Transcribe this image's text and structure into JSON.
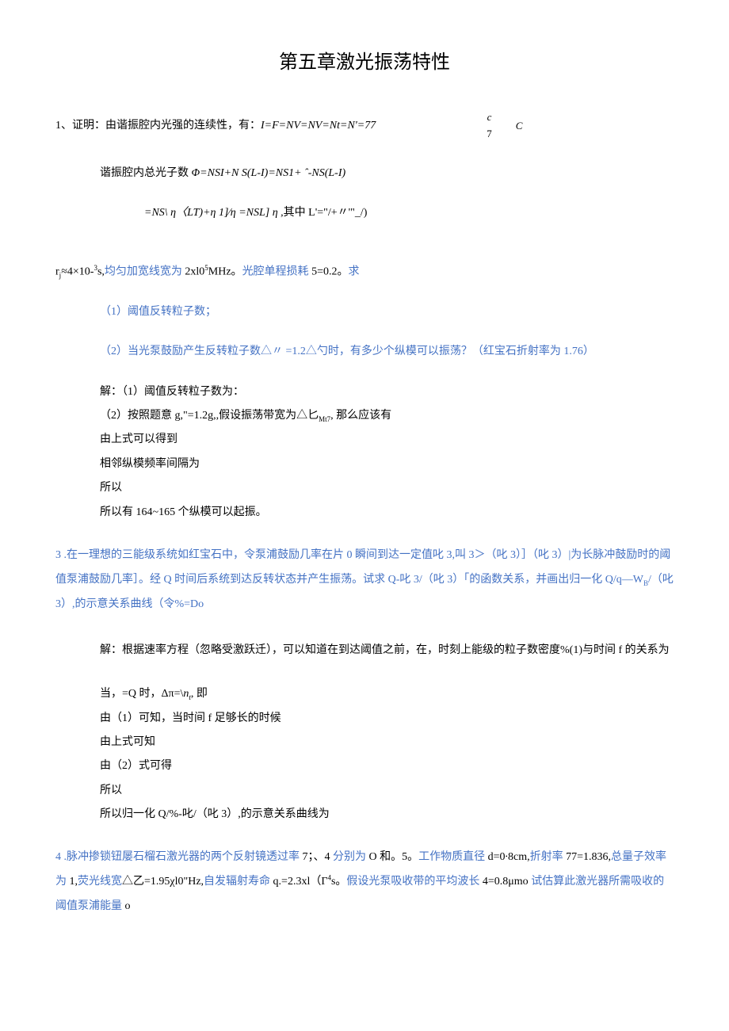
{
  "title": "第五章激光振荡特性",
  "p1": {
    "label": "1、证明：由谐振腔内光强的连续性，有：",
    "formula": "I=F=NV=NV=Nt=N'=77",
    "frac1_top": "c",
    "frac1_bot": "7",
    "frac2_top": "C"
  },
  "p2": {
    "prefix": "谐振腔内总光子数 ",
    "formula": "Φ=NSI+N S(L-I)=NS1+ ˆ-NS(L-I)"
  },
  "p3": {
    "formula": "=NS\\ η〈LT)+η 1]∕η =NSL] η ,",
    "suffix": "其中 L'=\"/+〃'\"_/)"
  },
  "p4": {
    "prefix": "r",
    "sub": "j",
    "mid1": "≈4×10-",
    "sup1": "3",
    "mid2": "s,",
    "blue1": "均匀加宽线宽为",
    "mid3": " 2xl0",
    "sup2": "5",
    "mid4": "MHz。",
    "blue2": "光腔单程损耗",
    "mid5": " 5=0.2。",
    "blue3": "求"
  },
  "p5": "（1）阈值反转粒子数；",
  "p6": "（2）当光泵鼓励产生反转粒子数△〃 =1.2△勺时，有多少个纵模可以振荡？（红宝石折射率为 1.76）",
  "p7": "解：（1）阈值反转粒子数为：",
  "p8": {
    "prefix": "（2）按照题意 g,\"=1.2g,,假设振荡带宽为△匕",
    "sub": "Mt7",
    "suffix": ", 那么应该有"
  },
  "p9": "由上式可以得到",
  "p10": "相邻纵模频率间隔为",
  "p11": "所以",
  "p12": "所以有 164~165 个纵模可以起振。",
  "p13": "3 .在一理想的三能级系统如红宝石中，令泵浦鼓励几率在片 0 瞬间到达一定值叱 3,叫 3＞（叱 3）］（叱 3）|为长脉冲鼓励时的阈值泵浦鼓励几率］。经 Q 时间后系统到达反转状态并产生振荡。试求 Q-叱 3/（叱 3）「的函数关系，并画出归一化 Q/q—W",
  "p13_sub": "B",
  "p13_suffix": "/（叱 3）,的示意关系曲线（令%=Do",
  "p14": "解：根据速率方程（忽略受激跃迁），可以知道在到达阈值之前，在，时刻上能级的粒子数密度%(1)与时间 f 的关系为",
  "p15": {
    "prefix": "当，=Q 时，Δπ=\\",
    "italic": "n",
    "sub": "t",
    "suffix": ", 即"
  },
  "p16": "由（1）可知，当时间 f 足够长的时候",
  "p17": "由上式可知",
  "p18": "由（2）式可得",
  "p19": "所以",
  "p20": "所以归一化 Q/%-叱/（叱 3）,的示意关系曲线为",
  "p21": {
    "num": "4 .",
    "blue1": "脉冲掺锁钮屡石榴石激光器的两个反射镜透过率",
    "black1": " 7；、4 ",
    "blue2": "分别为",
    "black2": " O 和。5。",
    "blue3": "工作物质直径",
    "black3": " d=0∙8cm,",
    "blue4": "折射率",
    "black4": " 77=1.836,",
    "blue5": "总量子效率为",
    "black5": " 1,",
    "blue6": "荧光线宽",
    "black6": "△乙=1.95χl0\"Hz,",
    "blue7": "自发辐射寿命",
    "black7": " q.=2.3xl（Γ",
    "sup": "4",
    "black8": "s。",
    "blue8": "假设光泵吸收带的平均波长",
    "black9": " 4=0.8μmo ",
    "blue9": "试估算此激光器所需吸收的阈值泵浦能量",
    "black10": " o"
  }
}
